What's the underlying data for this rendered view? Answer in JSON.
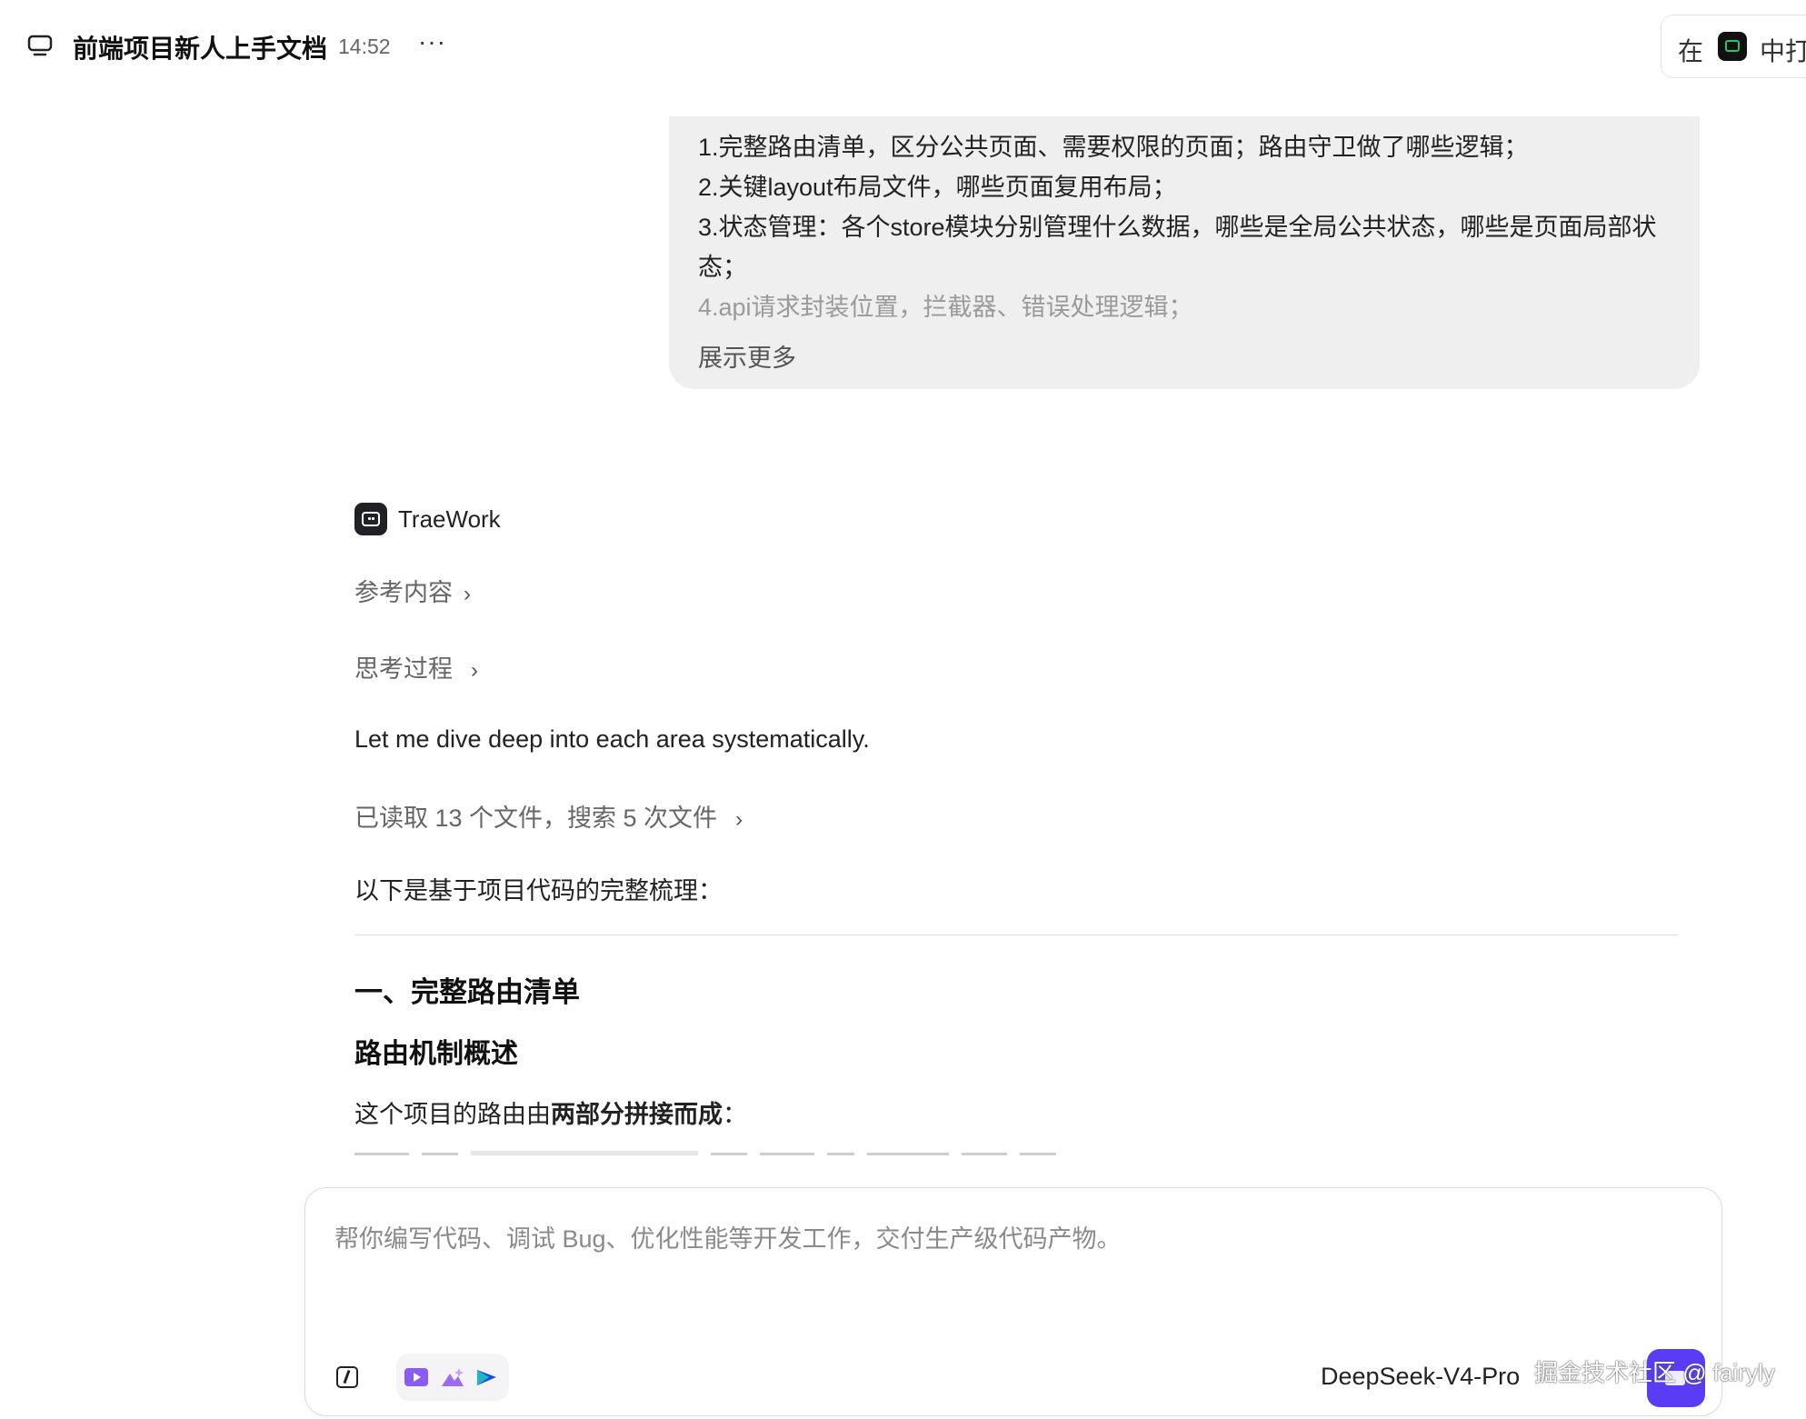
{
  "header": {
    "title": "前端项目新人上手文档",
    "time": "14:52",
    "more_label": "···",
    "right_prefix": "在",
    "right_suffix": "中打"
  },
  "user_message": {
    "lines": [
      "1.完整路由清单，区分公共页面、需要权限的页面；路由守卫做了哪些逻辑；",
      "2.关键layout布局文件，哪些页面复用布局；",
      "3.状态管理：各个store模块分别管理什么数据，哪些是全局公共状态，哪些是页面局部状态；",
      "4.api请求封装位置，拦截器、错误处理逻辑；"
    ],
    "expand_label": "展示更多"
  },
  "assistant": {
    "name": "TraeWork",
    "references_label": "参考内容",
    "thinking_label": "思考过程",
    "intro_text": "Let me dive deep into each area systematically.",
    "files_summary": "已读取 13 个文件，搜索 5 次文件",
    "lead_text": "以下是基于项目代码的完整梳理：",
    "heading1": "一、完整路由清单",
    "heading2": "路由机制概述",
    "para_prefix": "这个项目的路由由",
    "para_bold": "两部分拼接而成",
    "para_suffix": "："
  },
  "composer": {
    "placeholder": "帮你编写代码、调试 Bug、优化性能等开发工作，交付生产级代码产物。",
    "model_label": "DeepSeek-V4-Pro",
    "tools": [
      "video-tool-icon",
      "image-tool-icon",
      "brand-tool-icon"
    ]
  },
  "watermark": "掘金技术社区 @ fairyly",
  "colors": {
    "accent": "#5b3cf5",
    "bubble_bg": "#efefef",
    "brand_green": "#27c46b"
  }
}
